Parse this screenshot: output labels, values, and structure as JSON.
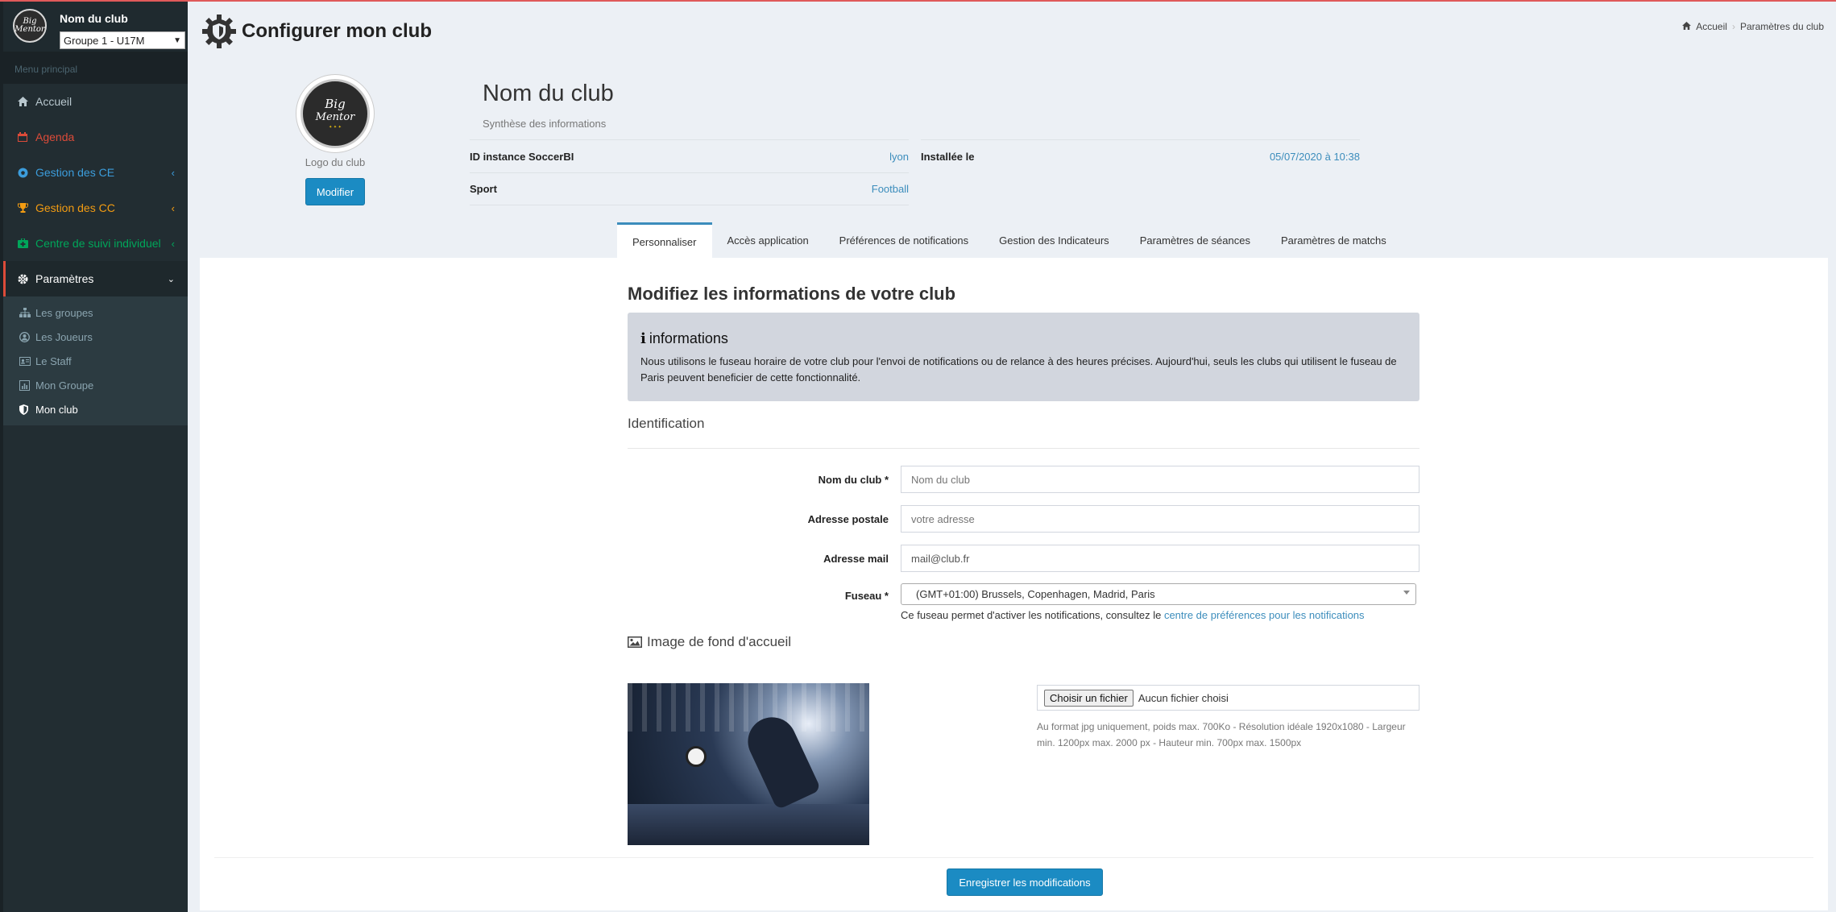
{
  "sidebar": {
    "club_name": "Nom du club",
    "group_select": "Groupe 1 - U17M",
    "section": "Menu principal",
    "items": [
      {
        "label": "Accueil",
        "icon": "home-icon"
      },
      {
        "label": "Agenda",
        "icon": "calendar-icon"
      },
      {
        "label": "Gestion des CE",
        "icon": "soccer-ball-icon"
      },
      {
        "label": "Gestion des CC",
        "icon": "trophy-icon"
      },
      {
        "label": "Centre de suivi individuel",
        "icon": "first-aid-icon"
      },
      {
        "label": "Paramètres",
        "icon": "gear-icon"
      }
    ],
    "subitems": [
      {
        "label": "Les groupes",
        "icon": "sitemap-icon"
      },
      {
        "label": "Les Joueurs",
        "icon": "user-circle-icon"
      },
      {
        "label": "Le Staff",
        "icon": "id-card-icon"
      },
      {
        "label": "Mon Groupe",
        "icon": "chart-icon"
      },
      {
        "label": "Mon club",
        "icon": "shield-icon"
      }
    ]
  },
  "header": {
    "title": "Configurer mon club",
    "breadcrumb": [
      "Accueil",
      "Paramètres du club"
    ]
  },
  "club": {
    "logo_lines": [
      "Big",
      "Mentor"
    ],
    "logo_label": "Logo du club",
    "modify_button": "Modifier",
    "name": "Nom du club",
    "subtitle": "Synthèse des informations",
    "info": [
      {
        "key": "ID instance SoccerBI",
        "value": "lyon"
      },
      {
        "key": "Installée le",
        "value": "05/07/2020 à 10:38"
      },
      {
        "key": "Sport",
        "value": "Football"
      }
    ]
  },
  "tabs": [
    "Personnaliser",
    "Accès application",
    "Préférences de notifications",
    "Gestion des Indicateurs",
    "Paramètres de séances",
    "Paramètres de matchs"
  ],
  "form": {
    "title": "Modifiez les informations de votre club",
    "alert_title": "informations",
    "alert_text": "Nous utilisons le fuseau horaire de votre club pour l'envoi de notifications ou de relance à des heures précises. Aujourd'hui, seuls les clubs qui utilisent le fuseau de Paris peuvent beneficier de cette fonctionnalité.",
    "section_identification": "Identification",
    "fields": {
      "name_label": "Nom du club *",
      "name_placeholder": "Nom du club",
      "address_label": "Adresse postale",
      "address_placeholder": "votre adresse",
      "email_label": "Adresse mail",
      "email_value": "mail@club.fr",
      "timezone_label": "Fuseau *",
      "timezone_value": "(GMT+01:00) Brussels, Copenhagen, Madrid, Paris"
    },
    "timezone_help": "Ce fuseau permet d'activer les notifications, consultez le",
    "timezone_help_link": "centre de préférences pour les notifications",
    "image_section": "Image de fond d'accueil",
    "file_button": "Choisir un fichier",
    "file_status": "Aucun fichier choisi",
    "file_help": "Au format jpg uniquement, poids max. 700Ko - Résolution idéale 1920x1080 - Largeur min. 1200px max. 2000 px - Hauteur min. 700px max. 1500px",
    "save_button": "Enregistrer les modifications"
  },
  "colors": {
    "sidebar_bg": "#222d32",
    "primary": "#1b8bc3",
    "link": "#3c8dbc",
    "danger": "#dd4b39",
    "warning": "#f39c12",
    "success": "#00a65a"
  }
}
